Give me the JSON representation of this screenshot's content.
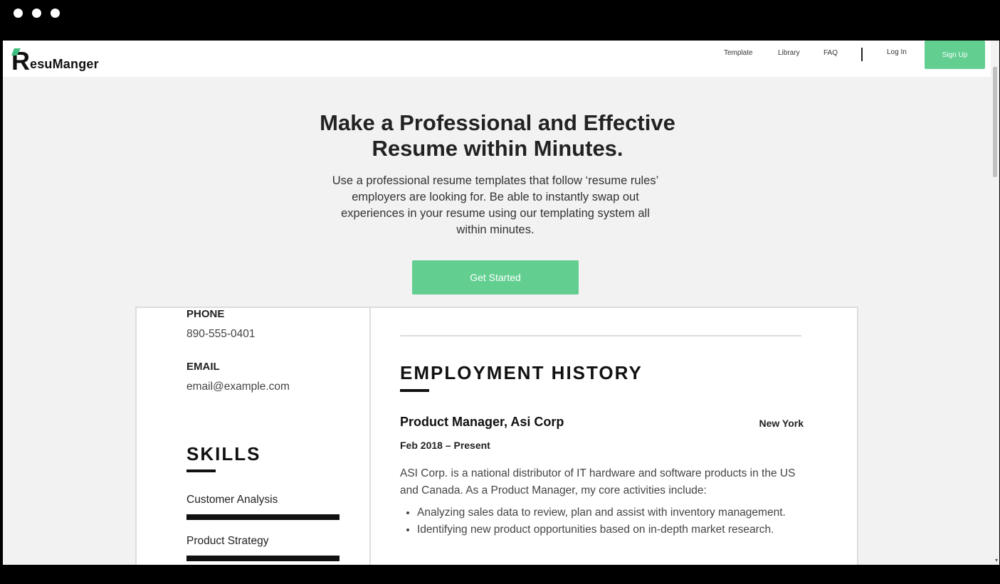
{
  "brand": {
    "logo_initial": "R",
    "logo_rest": "esuManger",
    "accent": "#62cf91"
  },
  "nav": {
    "links": [
      "Template",
      "Library",
      "FAQ"
    ],
    "login": "Log In",
    "signup": "Sign Up"
  },
  "hero": {
    "title_line1": "Make a Professional and Effective",
    "title_line2": "Resume within Minutes.",
    "subtitle": "Use a professional resume templates that follow ‘resume rules’ employers are looking for. Be able to instantly swap out experiences in your resume using our templating system all within minutes.",
    "cta": "Get Started"
  },
  "resume": {
    "phone_label": "PHONE",
    "phone": "890-555-0401",
    "email_label": "EMAIL",
    "email": "email@example.com",
    "skills_title": "SKILLS",
    "skills": [
      "Customer Analysis",
      "Product Strategy"
    ],
    "employment_title": "EMPLOYMENT HISTORY",
    "job": {
      "title": "Product Manager, Asi Corp",
      "location": "New York",
      "dates": "Feb 2018 – Present",
      "description": "ASI Corp. is a national distributor of IT hardware and software products in the US and Canada. As a Product Manager, my core activities include:",
      "bullets": [
        "Analyzing sales data to review, plan and assist with inventory management.",
        "Identifying new product opportunities based on in-depth market research."
      ]
    }
  }
}
